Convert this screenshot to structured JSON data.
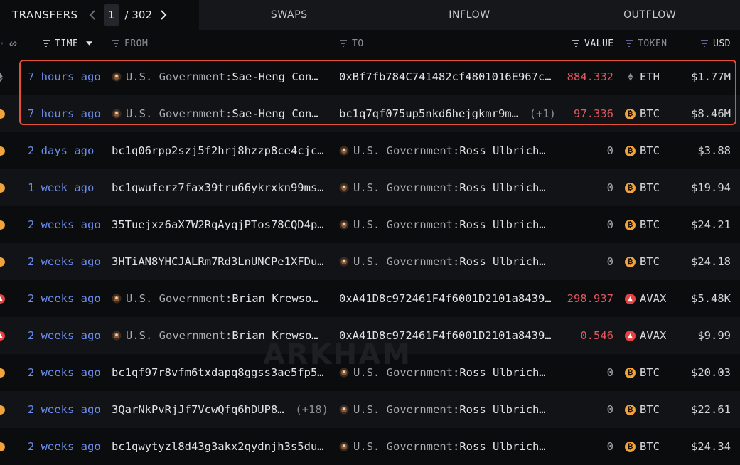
{
  "tabs": {
    "transfers": "TRANSFERS",
    "page_current": "1",
    "page_sep": "/ 302",
    "swaps": "SWAPS",
    "inflow": "INFLOW",
    "outflow": "OUTFLOW"
  },
  "columns": {
    "time": "TIME",
    "from": "FROM",
    "to": "TO",
    "value": "VALUE",
    "token": "TOKEN",
    "usd": "USD"
  },
  "watermark": "ARKHAM",
  "colors": {
    "accent_time": "#6d8ff0",
    "value_red": "#e5565e",
    "btc": "#f2a33b",
    "avax": "#e84142",
    "highlight": "#e5503a"
  },
  "rows": [
    {
      "chain": "eth",
      "time": "7 hours ago",
      "from_entity": "U.S. Government",
      "from_sub": "Sae-Heng Con…",
      "from_addr": "",
      "to_addr": "0xBf7fb784C741482cf4801016E967c…",
      "to_entity": "",
      "to_sub": "",
      "to_plus": "",
      "value": "884.332",
      "token": "ETH",
      "usd": "$1.77M"
    },
    {
      "chain": "btc",
      "time": "7 hours ago",
      "from_entity": "U.S. Government",
      "from_sub": "Sae-Heng Con…",
      "from_addr": "",
      "to_addr": "bc1q7qf075up5nkd6hejgkmr9ms…",
      "to_entity": "",
      "to_sub": "",
      "to_plus": "(+1)",
      "value": "97.336",
      "token": "BTC",
      "usd": "$8.46M"
    },
    {
      "chain": "btc",
      "time": "2 days ago",
      "from_entity": "",
      "from_sub": "",
      "from_addr": "bc1q06rpp2szj5f2hrj8hzzp8ce4cjc…",
      "to_addr": "",
      "to_entity": "U.S. Government",
      "to_sub": "Ross Ulbrich…",
      "to_plus": "",
      "value": "0",
      "token": "BTC",
      "usd": "$3.88"
    },
    {
      "chain": "btc",
      "time": "1 week ago",
      "from_entity": "",
      "from_sub": "",
      "from_addr": "bc1qwuferz7fax39tru66ykrxkn99ms…",
      "to_addr": "",
      "to_entity": "U.S. Government",
      "to_sub": "Ross Ulbrich…",
      "to_plus": "",
      "value": "0",
      "token": "BTC",
      "usd": "$19.94"
    },
    {
      "chain": "btc",
      "time": "2 weeks ago",
      "from_entity": "",
      "from_sub": "",
      "from_addr": "35Tuejxz6aX7W2RqAyqjPTos78CQD4p…",
      "to_addr": "",
      "to_entity": "U.S. Government",
      "to_sub": "Ross Ulbrich…",
      "to_plus": "",
      "value": "0",
      "token": "BTC",
      "usd": "$24.21"
    },
    {
      "chain": "btc",
      "time": "2 weeks ago",
      "from_entity": "",
      "from_sub": "",
      "from_addr": "3HTiAN8YHCJALRm7Rd3LnUNCPe1XFDu…",
      "to_addr": "",
      "to_entity": "U.S. Government",
      "to_sub": "Ross Ulbrich…",
      "to_plus": "",
      "value": "0",
      "token": "BTC",
      "usd": "$24.18"
    },
    {
      "chain": "avax",
      "time": "2 weeks ago",
      "from_entity": "U.S. Government",
      "from_sub": "Brian Krewso…",
      "from_addr": "",
      "to_addr": "0xA41D8c972461F4f6001D2101a8439…",
      "to_entity": "",
      "to_sub": "",
      "to_plus": "",
      "value": "298.937",
      "token": "AVAX",
      "usd": "$5.48K"
    },
    {
      "chain": "avax",
      "time": "2 weeks ago",
      "from_entity": "U.S. Government",
      "from_sub": "Brian Krewso…",
      "from_addr": "",
      "to_addr": "0xA41D8c972461F4f6001D2101a8439…",
      "to_entity": "",
      "to_sub": "",
      "to_plus": "",
      "value": "0.546",
      "token": "AVAX",
      "usd": "$9.99"
    },
    {
      "chain": "btc",
      "time": "2 weeks ago",
      "from_entity": "",
      "from_sub": "",
      "from_addr": "bc1qf97r8vfm6txdapq8ggss3ae5fp5…",
      "to_addr": "",
      "to_entity": "U.S. Government",
      "to_sub": "Ross Ulbrich…",
      "to_plus": "",
      "value": "0",
      "token": "BTC",
      "usd": "$20.03"
    },
    {
      "chain": "btc",
      "time": "2 weeks ago",
      "from_entity": "",
      "from_sub": "",
      "from_addr": "3QarNkPvRjJf7VcwQfq6hDUP81…",
      "from_plus": "(+18)",
      "to_addr": "",
      "to_entity": "U.S. Government",
      "to_sub": "Ross Ulbrich…",
      "to_plus": "",
      "value": "0",
      "token": "BTC",
      "usd": "$22.61"
    },
    {
      "chain": "btc",
      "time": "2 weeks ago",
      "from_entity": "",
      "from_sub": "",
      "from_addr": "bc1qwytyzl8d43g3akx2qydnjh3s5du…",
      "to_addr": "",
      "to_entity": "U.S. Government",
      "to_sub": "Ross Ulbrich…",
      "to_plus": "",
      "value": "0",
      "token": "BTC",
      "usd": "$24.34"
    }
  ]
}
